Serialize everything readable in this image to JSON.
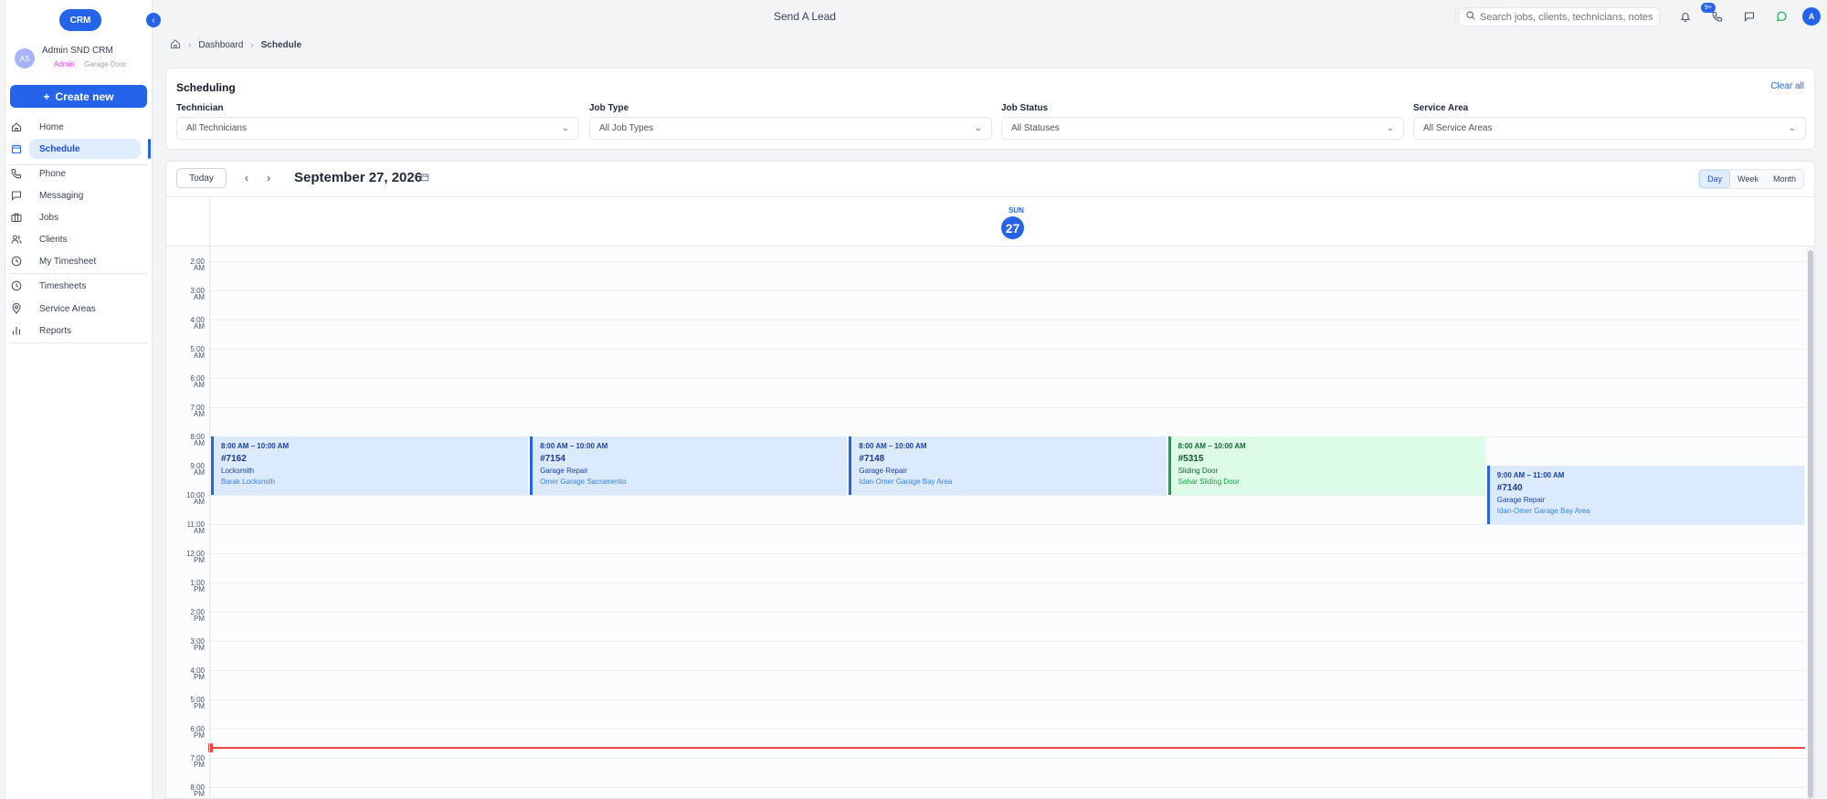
{
  "sidebar": {
    "logo": "CRM",
    "collapse_icon": "chevron-left-icon",
    "user": {
      "initials": "AS",
      "name": "Admin SND CRM",
      "role": "Admin",
      "org": "Garage Door"
    },
    "create_label": "Create new",
    "items": [
      {
        "label": "Home",
        "icon": "home-icon"
      },
      {
        "label": "Schedule",
        "icon": "calendar-icon",
        "active": true
      },
      {
        "label": "Phone",
        "icon": "phone-icon"
      },
      {
        "label": "Messaging",
        "icon": "chat-icon"
      },
      {
        "label": "Jobs",
        "icon": "briefcase-icon"
      },
      {
        "label": "Clients",
        "icon": "users-icon"
      },
      {
        "label": "My Timesheet",
        "icon": "clock-icon"
      },
      {
        "label": "Timesheets",
        "icon": "clock-icon"
      },
      {
        "label": "Service Areas",
        "icon": "map-pin-icon"
      },
      {
        "label": "Reports",
        "icon": "bar-chart-icon"
      }
    ]
  },
  "topbar": {
    "title": "Send A Lead",
    "search_placeholder": "Search jobs, clients, technicians, notes...",
    "notification_count": "9+",
    "avatar_initial": "A"
  },
  "breadcrumb": {
    "items": [
      "Dashboard",
      "Schedule"
    ]
  },
  "filters": {
    "title": "Scheduling",
    "clear_label": "Clear all",
    "groups": [
      {
        "label": "Technician",
        "value": "All Technicians"
      },
      {
        "label": "Job Type",
        "value": "All Job Types"
      },
      {
        "label": "Job Status",
        "value": "All Statuses"
      },
      {
        "label": "Service Area",
        "value": "All Service Areas"
      }
    ]
  },
  "calendar": {
    "today_label": "Today",
    "date_title": "September 27, 2026",
    "views": [
      "Day",
      "Week",
      "Month"
    ],
    "active_view": "Day",
    "day_name": "SUN",
    "day_number": "27",
    "hours": [
      [
        "2:00",
        "AM"
      ],
      [
        "3:00",
        "AM"
      ],
      [
        "4:00",
        "AM"
      ],
      [
        "5:00",
        "AM"
      ],
      [
        "6:00",
        "AM"
      ],
      [
        "7:00",
        "AM"
      ],
      [
        "8:00",
        "AM"
      ],
      [
        "9:00",
        "AM"
      ],
      [
        "10:00",
        "AM"
      ],
      [
        "11:00",
        "AM"
      ],
      [
        "12:00",
        "PM"
      ],
      [
        "1:00",
        "PM"
      ],
      [
        "2:00",
        "PM"
      ],
      [
        "3:00",
        "PM"
      ],
      [
        "4:00",
        "PM"
      ],
      [
        "5:00",
        "PM"
      ],
      [
        "6:00",
        "PM"
      ],
      [
        "7:00",
        "PM"
      ],
      [
        "8:00",
        "PM"
      ]
    ],
    "current_time_hour": 18.0,
    "events": [
      {
        "time": "8:00 AM – 10:00 AM",
        "id": "#7162",
        "type": "Locksmith",
        "tech": "Barak Locksmith",
        "start": 8,
        "end": 10,
        "color": "#2563eb"
      },
      {
        "time": "8:00 AM – 10:00 AM",
        "id": "#7154",
        "type": "Garage Repair",
        "tech": "Omer Garage Sacramento",
        "start": 8,
        "end": 10,
        "color": "#2563eb"
      },
      {
        "time": "8:00 AM – 10:00 AM",
        "id": "#7148",
        "type": "Garage Repair",
        "tech": "Idan-Omer Garage Bay Area",
        "start": 8,
        "end": 10,
        "color": "#2563eb"
      },
      {
        "time": "8:00 AM – 10:00 AM",
        "id": "#5315",
        "type": "Sliding Door",
        "tech": "Sahar Sliding Door",
        "start": 8,
        "end": 10,
        "color": "#16a34a"
      },
      {
        "time": "9:00 AM – 11:00 AM",
        "id": "#7140",
        "type": "Garage Repair",
        "tech": "Idan-Omer Garage Bay Area",
        "start": 9,
        "end": 11,
        "color": "#2563eb"
      }
    ]
  }
}
